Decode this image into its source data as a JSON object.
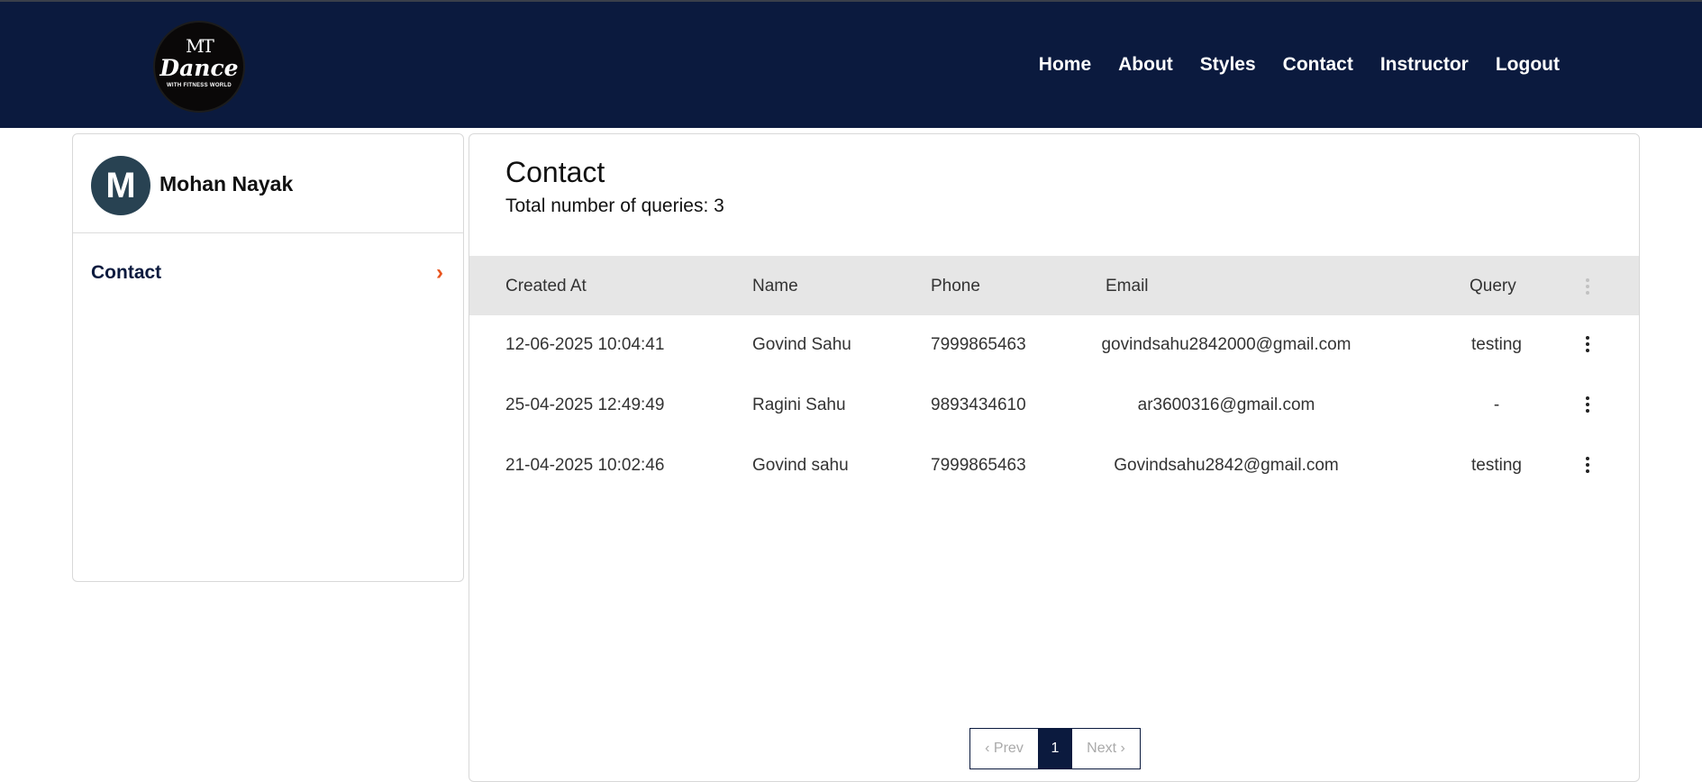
{
  "logo": {
    "mt": "MT",
    "dance": "Dance",
    "tagline": "WITH FITNESS WORLD"
  },
  "nav": {
    "items": [
      "Home",
      "About",
      "Styles",
      "Contact",
      "Instructor",
      "Logout"
    ]
  },
  "sidebar": {
    "avatar_letter": "M",
    "user_name": "Mohan Nayak",
    "item": "Contact",
    "chevron": "›"
  },
  "page": {
    "title": "Contact",
    "total": "Total number of queries: 3"
  },
  "table": {
    "headers": [
      "Created At",
      "Name",
      "Phone",
      "Email",
      "Query"
    ],
    "rows": [
      [
        "12-06-2025 10:04:41",
        "Govind Sahu",
        "7999865463",
        "govindsahu2842000@gmail.com",
        "testing"
      ],
      [
        "25-04-2025 12:49:49",
        "Ragini Sahu",
        "9893434610",
        "ar3600316@gmail.com",
        "-"
      ],
      [
        "21-04-2025 10:02:46",
        "Govind sahu",
        "7999865463",
        "Govindsahu2842@gmail.com",
        "testing"
      ]
    ]
  },
  "pagination": {
    "prev": "‹ Prev",
    "current": "1",
    "next": "Next ›"
  },
  "colors": {
    "header_bg": "#0b1a3e",
    "accent": "#e8551f",
    "avatar_bg": "#284252",
    "table_head_bg": "#e6e6e6"
  }
}
